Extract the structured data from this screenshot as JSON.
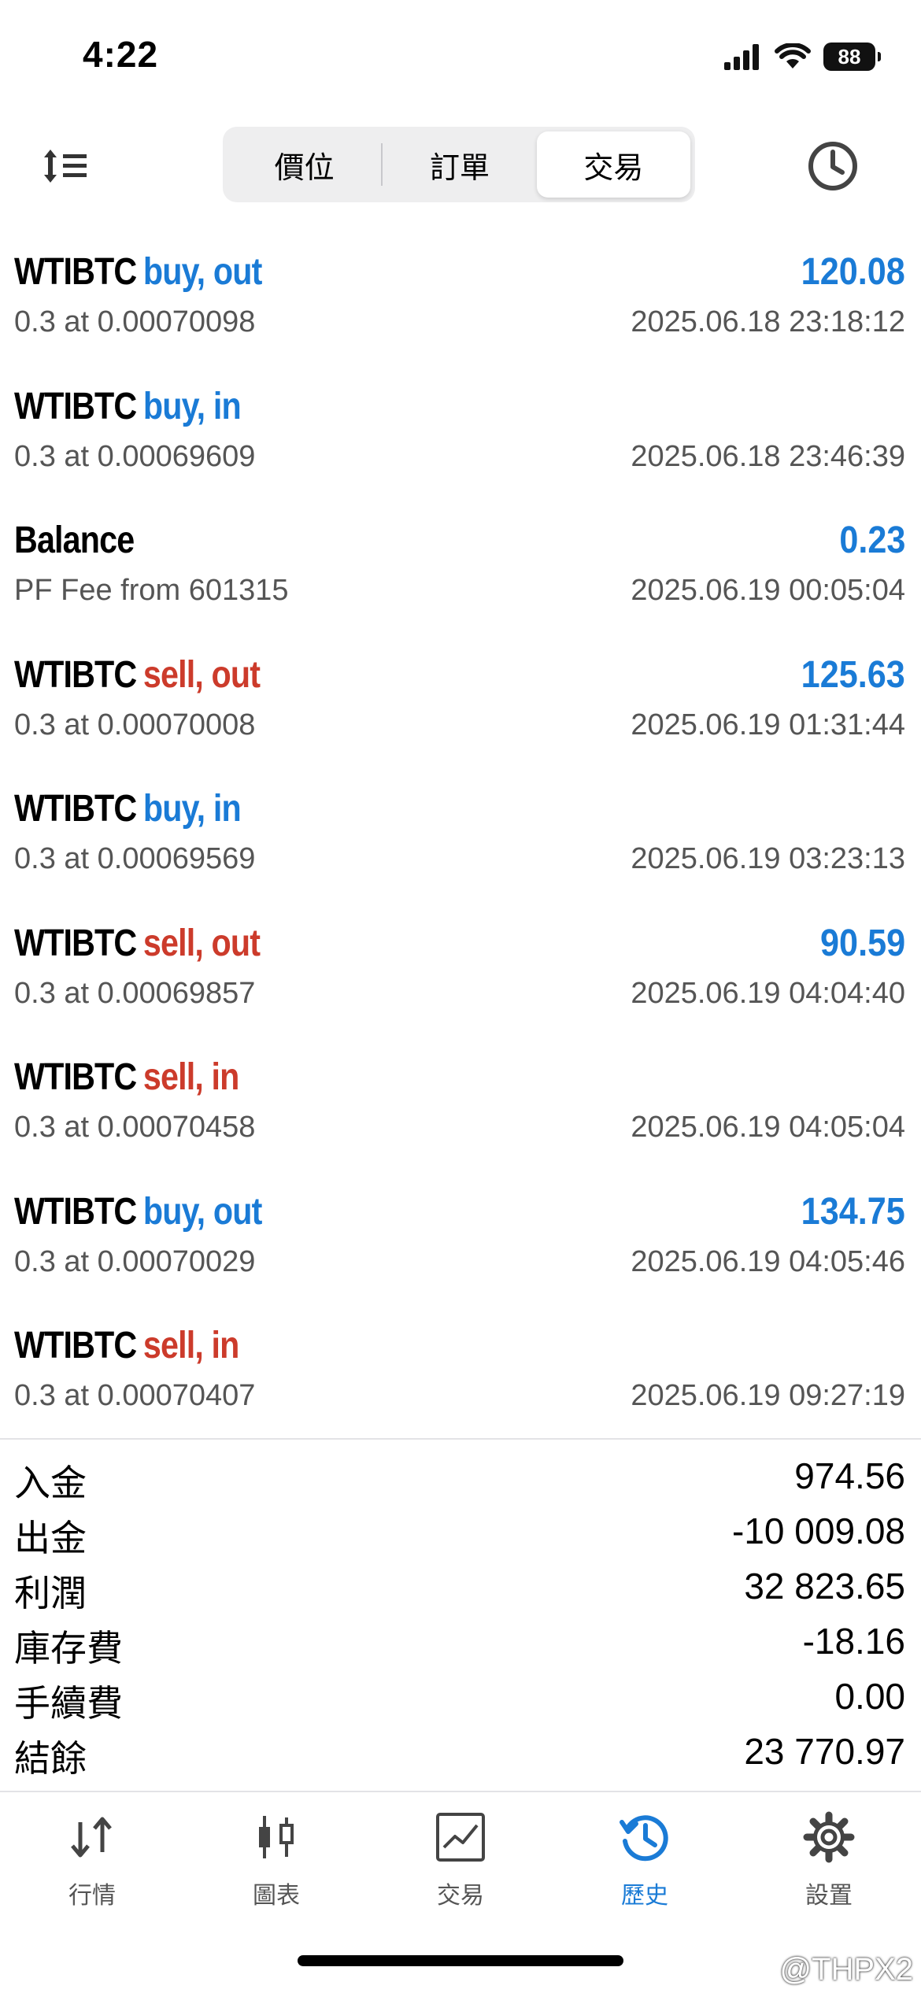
{
  "status_bar": {
    "time": "4:22",
    "battery": "88"
  },
  "segments": [
    "價位",
    "訂單",
    "交易"
  ],
  "active_segment": 2,
  "deals": [
    {
      "symbol": "WTIBTC",
      "type": "buy, out",
      "side": "buy",
      "profit": "120.08",
      "detail": "0.3 at 0.00070098",
      "time": "2025.06.18 23:18:12"
    },
    {
      "symbol": "WTIBTC",
      "type": "buy, in",
      "side": "buy",
      "profit": "",
      "detail": "0.3 at 0.00069609",
      "time": "2025.06.18 23:46:39"
    },
    {
      "symbol": "Balance",
      "type": "",
      "side": "",
      "profit": "0.23",
      "detail": "PF Fee from 601315",
      "time": "2025.06.19 00:05:04"
    },
    {
      "symbol": "WTIBTC",
      "type": "sell, out",
      "side": "sell",
      "profit": "125.63",
      "detail": "0.3 at 0.00070008",
      "time": "2025.06.19 01:31:44"
    },
    {
      "symbol": "WTIBTC",
      "type": "buy, in",
      "side": "buy",
      "profit": "",
      "detail": "0.3 at 0.00069569",
      "time": "2025.06.19 03:23:13"
    },
    {
      "symbol": "WTIBTC",
      "type": "sell, out",
      "side": "sell",
      "profit": "90.59",
      "detail": "0.3 at 0.00069857",
      "time": "2025.06.19 04:04:40"
    },
    {
      "symbol": "WTIBTC",
      "type": "sell, in",
      "side": "sell",
      "profit": "",
      "detail": "0.3 at 0.00070458",
      "time": "2025.06.19 04:05:04"
    },
    {
      "symbol": "WTIBTC",
      "type": "buy, out",
      "side": "buy",
      "profit": "134.75",
      "detail": "0.3 at 0.00070029",
      "time": "2025.06.19 04:05:46"
    },
    {
      "symbol": "WTIBTC",
      "type": "sell, in",
      "side": "sell",
      "profit": "",
      "detail": "0.3 at 0.00070407",
      "time": "2025.06.19 09:27:19"
    }
  ],
  "summary": [
    {
      "label": "入金",
      "value": "974.56"
    },
    {
      "label": "出金",
      "value": "-10 009.08"
    },
    {
      "label": "利潤",
      "value": "32 823.65"
    },
    {
      "label": "庫存費",
      "value": "-18.16"
    },
    {
      "label": "手續費",
      "value": "0.00"
    },
    {
      "label": "結餘",
      "value": "23 770.97"
    }
  ],
  "tabs": [
    {
      "label": "行情",
      "icon": "quotes-arrows-icon"
    },
    {
      "label": "圖表",
      "icon": "candlestick-chart-icon"
    },
    {
      "label": "交易",
      "icon": "trade-chart-icon"
    },
    {
      "label": "歷史",
      "icon": "history-clock-icon"
    },
    {
      "label": "設置",
      "icon": "settings-gear-icon"
    }
  ],
  "active_tab": 3,
  "watermark": "@THPX2",
  "colors": {
    "accent_blue": "#1a7bd6",
    "sell_red": "#cc3b2b",
    "muted_text": "#555555"
  }
}
